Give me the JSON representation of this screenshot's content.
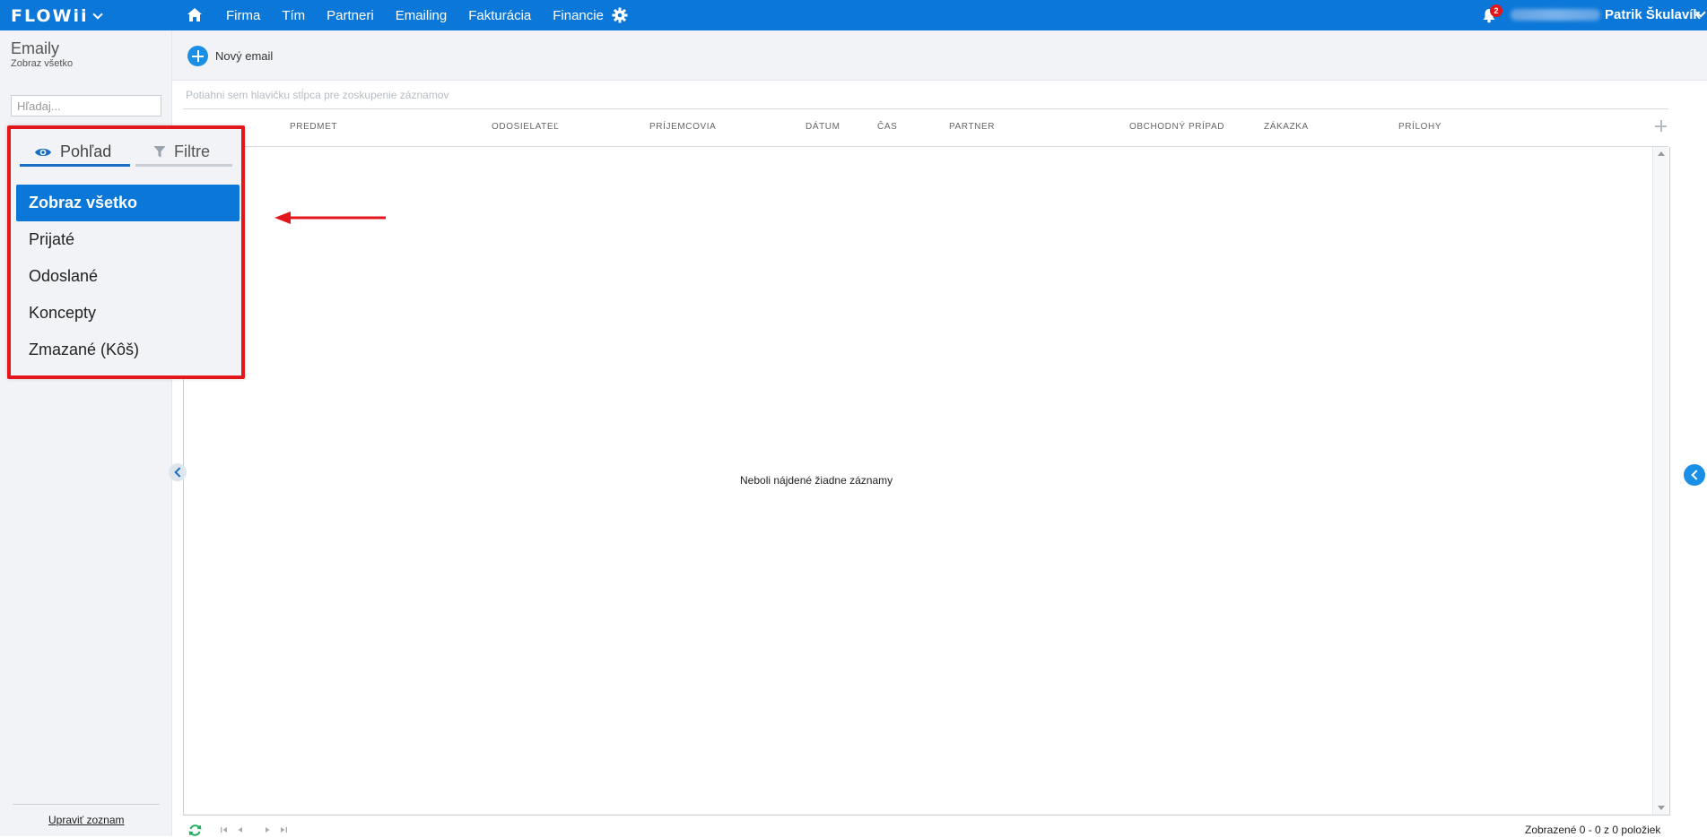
{
  "topbar": {
    "logo": "FLOWii",
    "nav": [
      "Firma",
      "Tím",
      "Partneri",
      "Emailing",
      "Fakturácia",
      "Financie"
    ],
    "notifications_count": "2",
    "user_name": "Patrik Škulavík"
  },
  "left_panel": {
    "title": "Emaily",
    "subtitle": "Zobraz všetko",
    "search_placeholder": "Hľadaj...",
    "edit_list_link": "Upraviť zoznam"
  },
  "toolbar": {
    "new_email_label": "Nový email"
  },
  "grid": {
    "group_hint": "Potiahni sem hlavičku stĺpca pre zoskupenie záznamov",
    "columns": [
      "PREDMET",
      "ODOSIELATEĽ",
      "PRÍJEMCOVIA",
      "DÁTUM",
      "ČAS",
      "PARTNER",
      "OBCHODNÝ PRÍPAD",
      "ZÁKAZKA",
      "PRÍLOHY"
    ],
    "empty_message": "Neboli nájdené žiadne záznamy",
    "count_text": "Zobrazené 0 - 0 z 0 položiek"
  },
  "view_popup": {
    "tabs": [
      {
        "label": "Pohľad",
        "icon": "eye-icon",
        "active": true
      },
      {
        "label": "Filtre",
        "icon": "filter-icon",
        "active": false
      }
    ],
    "items": [
      {
        "label": "Zobraz všetko",
        "active": true
      },
      {
        "label": "Prijaté",
        "active": false
      },
      {
        "label": "Odoslané",
        "active": false
      },
      {
        "label": "Koncepty",
        "active": false
      },
      {
        "label": "Zmazané (Kôš)",
        "active": false
      }
    ]
  },
  "colors": {
    "accent": "#0b77d8",
    "highlight_border": "#e3161b",
    "badge": "#e3161b"
  }
}
